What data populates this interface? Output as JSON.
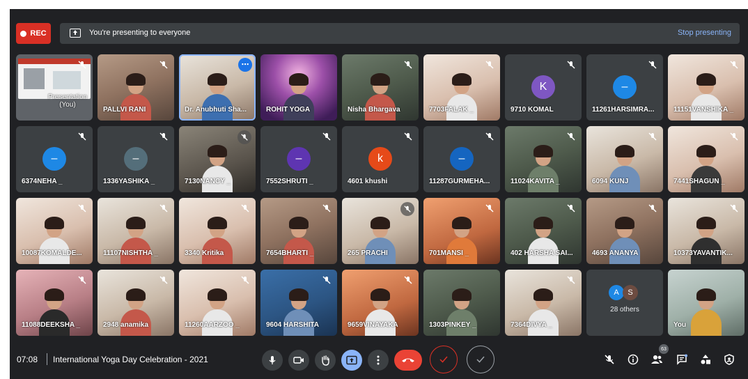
{
  "topbar": {
    "rec_label": "REC",
    "presenting_text": "You're presenting to everyone",
    "stop_label": "Stop presenting"
  },
  "tiles": [
    {
      "type": "presentation",
      "name": "Presentation (You)"
    },
    {
      "type": "video",
      "name": "PALLVI RANI"
    },
    {
      "type": "video",
      "name": "Dr. Anubhuti Sha..."
    },
    {
      "type": "video",
      "name": "ROHIT YOGA"
    },
    {
      "type": "video",
      "name": "Nisha Bhargava"
    },
    {
      "type": "video",
      "name": "7703FALAK _"
    },
    {
      "type": "avatar",
      "name": "9710 KOMAL",
      "initial": "K",
      "color": "#7e57c2"
    },
    {
      "type": "avatar",
      "name": "11261HARSIMRA...",
      "initial": "–",
      "color": "#1e88e5"
    },
    {
      "type": "video",
      "name": "11151VANSHIKA _"
    },
    {
      "type": "avatar",
      "name": "6374NEHA _",
      "initial": "–",
      "color": "#1e88e5"
    },
    {
      "type": "avatar",
      "name": "1336YASHIKA _",
      "initial": "–",
      "color": "#546e7a"
    },
    {
      "type": "video",
      "name": "7130NANCY _"
    },
    {
      "type": "avatar",
      "name": "7552SHRUTI _",
      "initial": "–",
      "color": "#5e35b1"
    },
    {
      "type": "avatar",
      "name": "4601 khushi",
      "initial": "k",
      "color": "#e64a19"
    },
    {
      "type": "avatar",
      "name": "11287GURMEHA...",
      "initial": "–",
      "color": "#1565c0"
    },
    {
      "type": "video",
      "name": "11024KAVITA _"
    },
    {
      "type": "video",
      "name": "6094 KUNJ"
    },
    {
      "type": "video",
      "name": "7441SHAGUN _"
    },
    {
      "type": "video",
      "name": "10087KOMALDE..."
    },
    {
      "type": "video",
      "name": "11107NISHTHA _"
    },
    {
      "type": "video",
      "name": "3340 Kritika"
    },
    {
      "type": "video",
      "name": "7654BHARTI _"
    },
    {
      "type": "video",
      "name": "265 PRACHI"
    },
    {
      "type": "video",
      "name": "701MANSI _"
    },
    {
      "type": "video",
      "name": "402 HARSHA SAI..."
    },
    {
      "type": "video",
      "name": "4693 ANANYA"
    },
    {
      "type": "video",
      "name": "10373YAVANTIK..."
    },
    {
      "type": "video",
      "name": "11088DEEKSHA _"
    },
    {
      "type": "video",
      "name": "2948 anamika"
    },
    {
      "type": "video",
      "name": "11260AARZOO _"
    },
    {
      "type": "video",
      "name": "9604 HARSHITA"
    },
    {
      "type": "video",
      "name": "9659VINAYAKA"
    },
    {
      "type": "video",
      "name": "1303PINKEY _"
    },
    {
      "type": "video",
      "name": "7364DIVYA _"
    },
    {
      "type": "others",
      "count_text": "28 others",
      "initials": [
        "A",
        "S"
      ]
    },
    {
      "type": "video",
      "name": "You"
    }
  ],
  "bottombar": {
    "time": "07:08",
    "meeting_title": "International Yoga Day Celebration - 2021",
    "participants_count": "63"
  }
}
